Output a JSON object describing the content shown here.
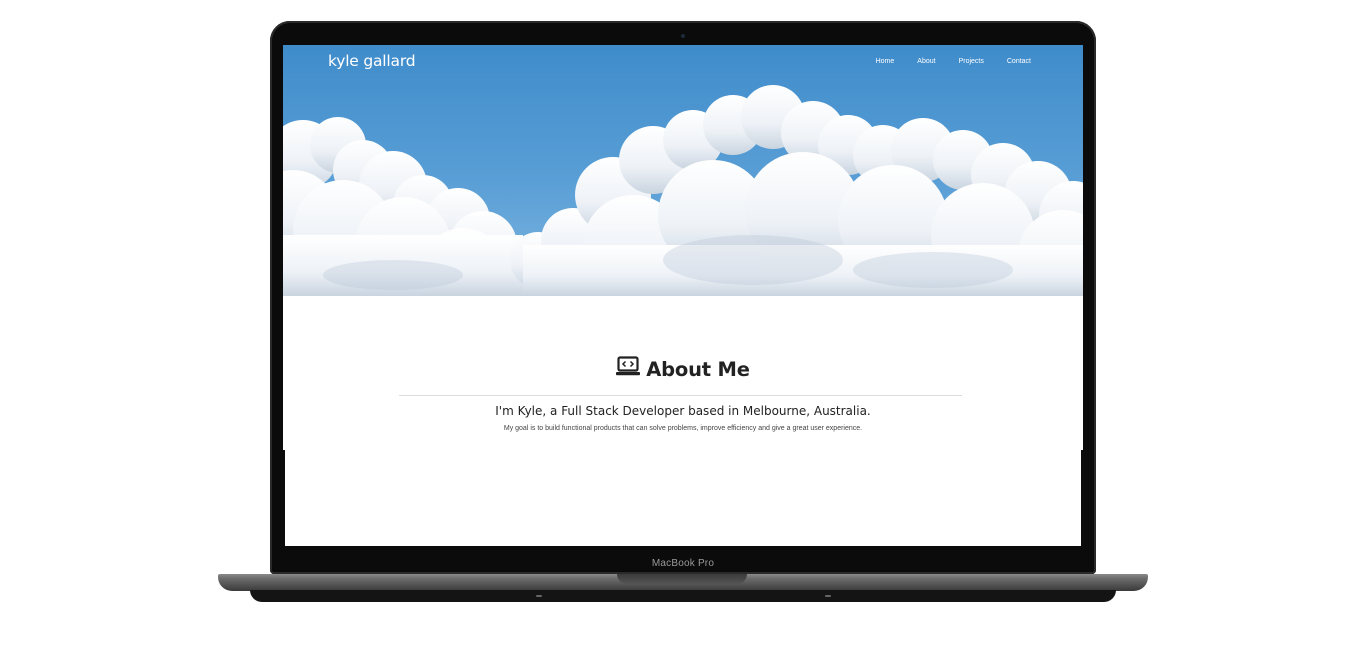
{
  "device": {
    "model_label": "MacBook Pro"
  },
  "site": {
    "brand": "kyle gallard",
    "nav": [
      {
        "label": "Home"
      },
      {
        "label": "About"
      },
      {
        "label": "Projects"
      },
      {
        "label": "Contact"
      }
    ]
  },
  "about": {
    "icon": "laptop-code-icon",
    "title": "About Me",
    "intro": "I'm Kyle, a Full Stack Developer based in Melbourne, Australia.",
    "goal": "My goal is to build functional products that can solve problems, improve efficiency and give a great user experience."
  },
  "colors": {
    "sky": "#4a94cf",
    "text_dark": "#222222",
    "bezel": "#0b0b0b"
  }
}
